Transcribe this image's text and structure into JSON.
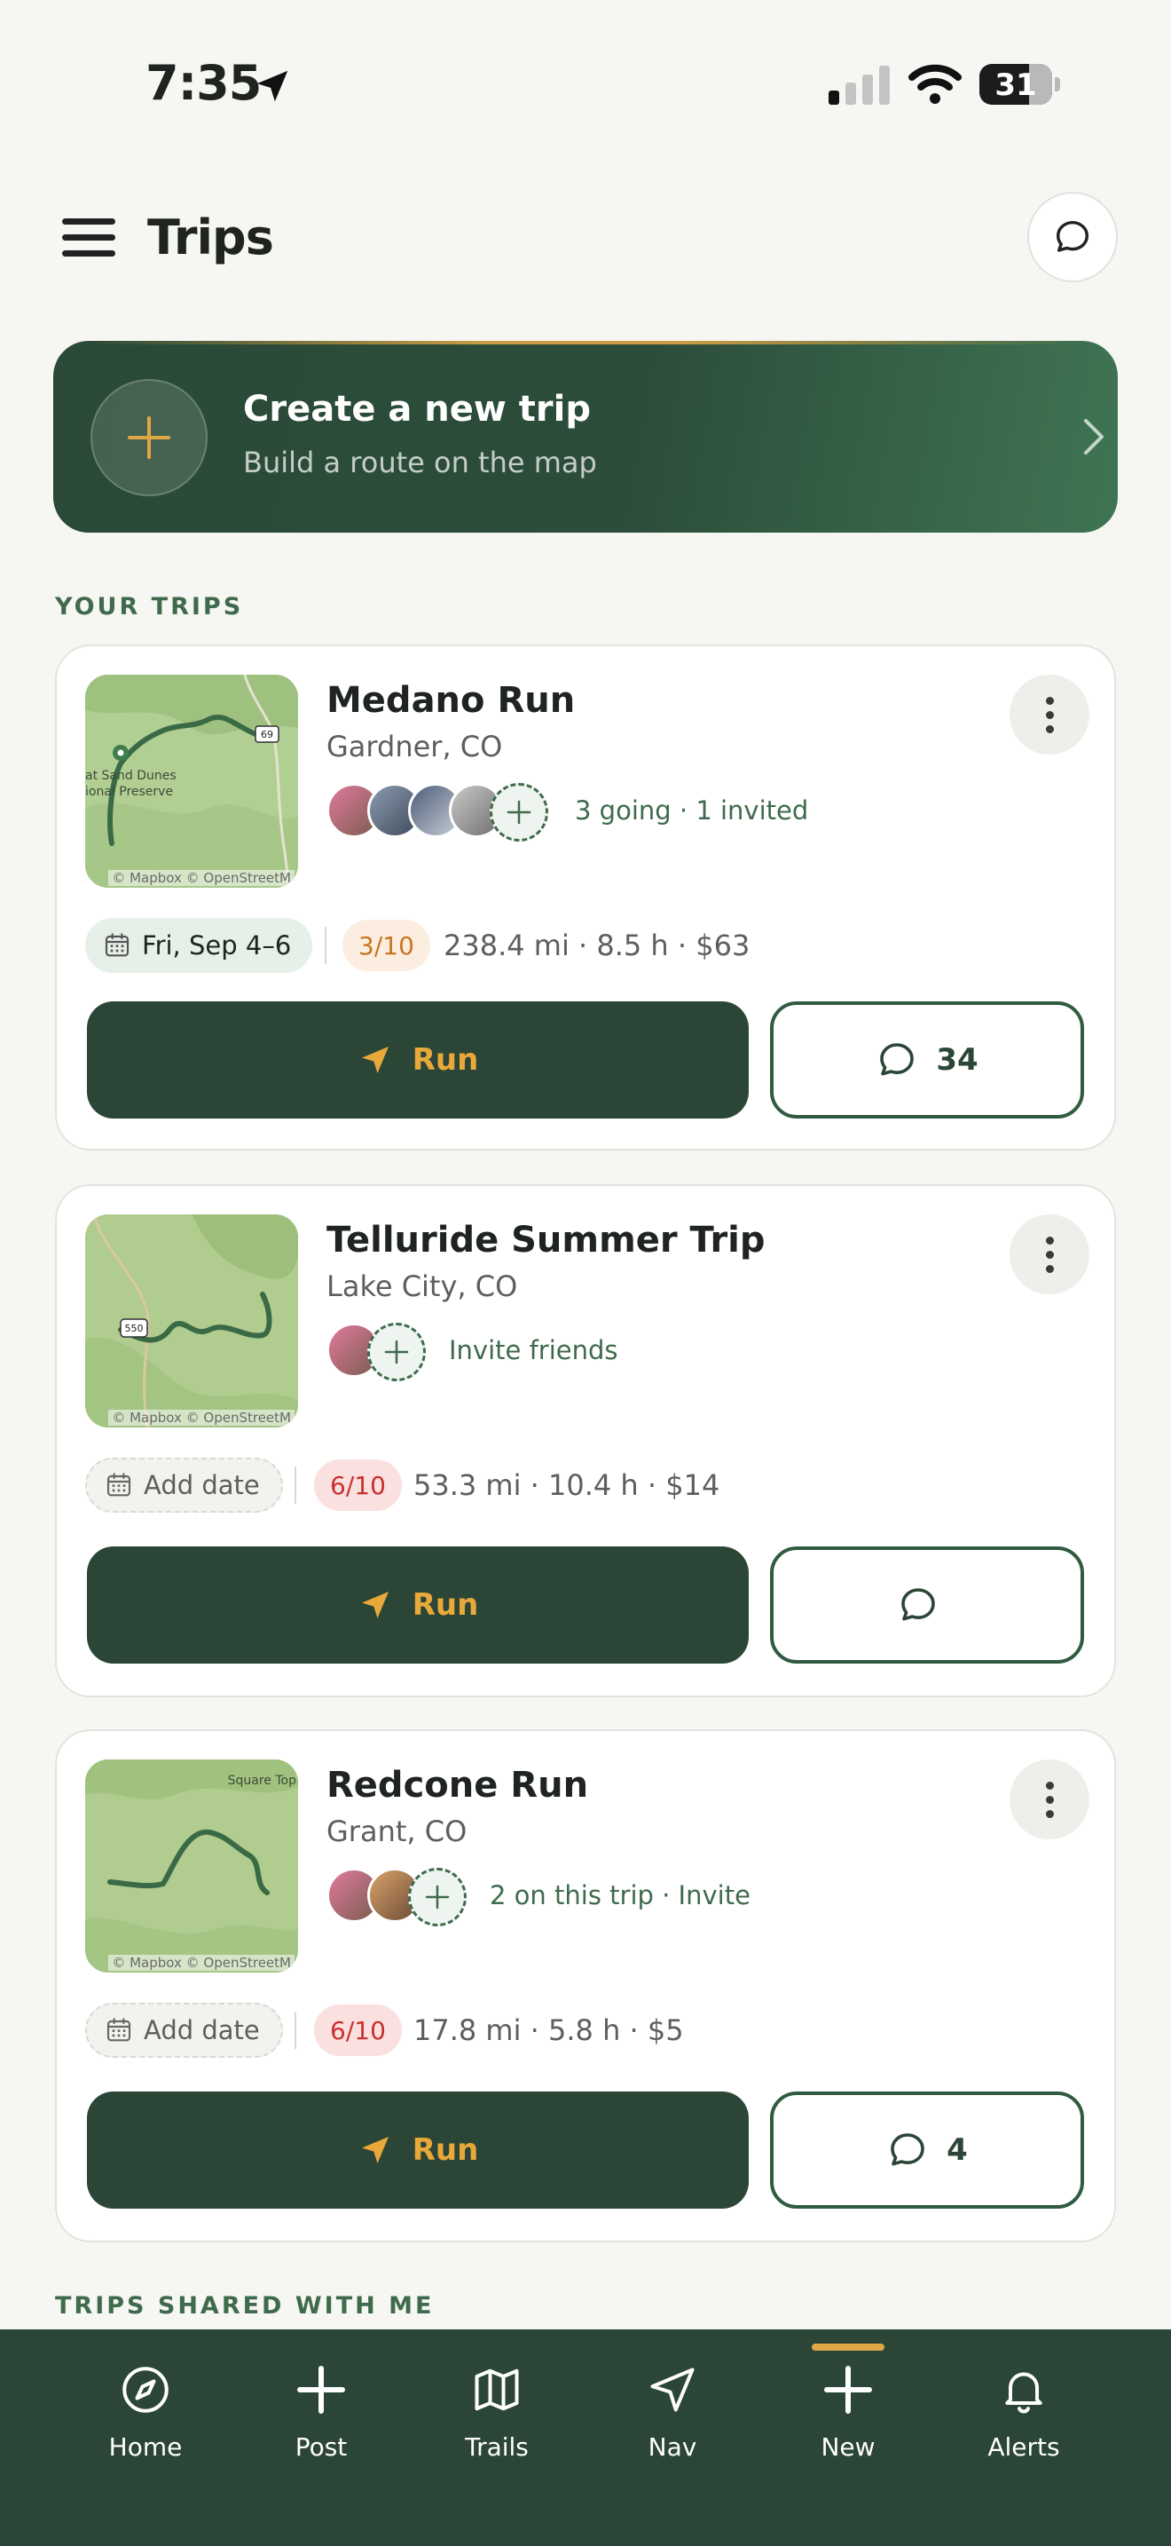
{
  "status_bar": {
    "time": "7:35",
    "battery": "31"
  },
  "header": {
    "title": "Trips"
  },
  "create_trip": {
    "title": "Create a new trip",
    "subtitle": "Build a route on the map"
  },
  "sections": {
    "your_trips": "YOUR TRIPS",
    "shared_with_me": "TRIPS SHARED WITH ME"
  },
  "map_attribution": "© Mapbox © OpenStreetM",
  "trips": [
    {
      "name": "Medano Run",
      "location": "Gardner, CO",
      "map_labels": [
        "at Sand Dunes",
        "ional Preserve",
        "69"
      ],
      "people_text": "3 going · 1 invited",
      "date": "Fri, Sep 4–6",
      "rating": "3/10",
      "stats": "238.4 mi · 8.5 h · $63",
      "run_label": "Run",
      "comments": "34"
    },
    {
      "name": "Telluride Summer Trip",
      "location": "Lake City, CO",
      "map_labels": [
        "550"
      ],
      "people_text": "Invite friends",
      "date": "Add date",
      "rating": "6/10",
      "stats": "53.3 mi · 10.4 h · $14",
      "run_label": "Run",
      "comments": ""
    },
    {
      "name": "Redcone Run",
      "location": "Grant, CO",
      "map_labels": [
        "Square Top"
      ],
      "people_text": "2 on this trip · Invite",
      "date": "Add date",
      "rating": "6/10",
      "stats": "17.8 mi · 5.8 h · $5",
      "run_label": "Run",
      "comments": "4"
    }
  ],
  "nav": [
    {
      "label": "Home",
      "icon": "compass-icon"
    },
    {
      "label": "Post",
      "icon": "plus-icon"
    },
    {
      "label": "Trails",
      "icon": "map-icon"
    },
    {
      "label": "Nav",
      "icon": "navigation-arrow-icon"
    },
    {
      "label": "New",
      "icon": "plus-icon",
      "active": true
    },
    {
      "label": "Alerts",
      "icon": "bell-icon"
    }
  ],
  "colors": {
    "primary": "#2b4636",
    "accent": "#e0a745",
    "rating_mid": "#c9751f",
    "rating_hard": "#c8302f"
  }
}
